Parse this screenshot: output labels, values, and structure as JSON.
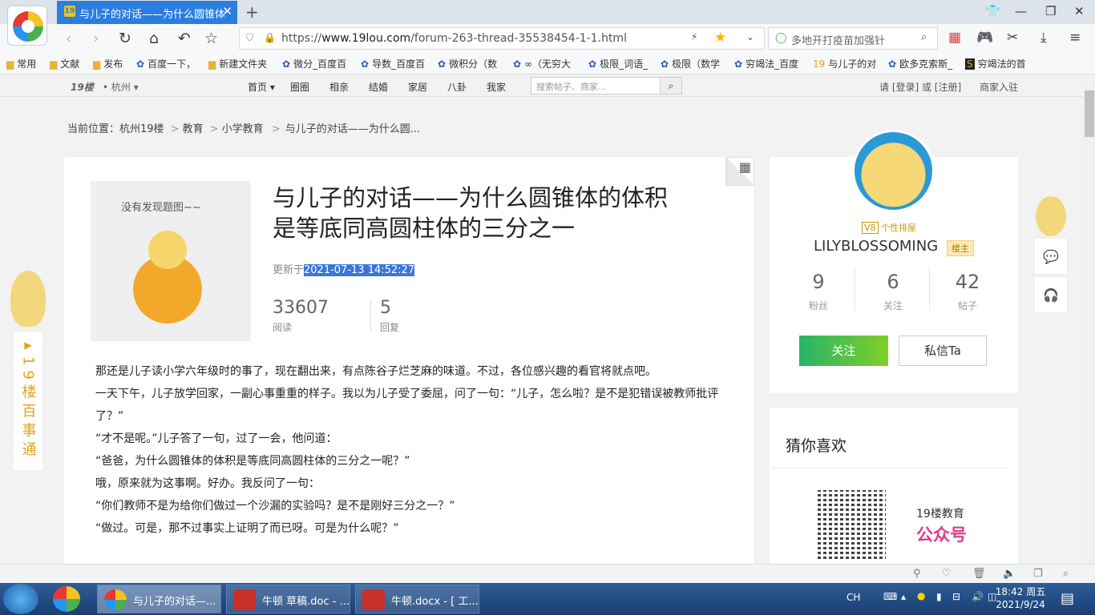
{
  "browser": {
    "tab_title": "与儿子的对话——为什么圆锥体",
    "tab_icon": "19",
    "url_prefix": "https://",
    "url_domain": "www.19lou.com",
    "url_path": "/forum-263-thread-35538454-1-1.html",
    "search_placeholder": "多地开打疫苗加强针"
  },
  "bookmarks": [
    {
      "icon": "folder",
      "label": "常用"
    },
    {
      "icon": "folder",
      "label": "文献"
    },
    {
      "icon": "folder",
      "label": "发布"
    },
    {
      "icon": "paw",
      "label": "百度一下，"
    },
    {
      "icon": "folder",
      "label": "新建文件夹"
    },
    {
      "icon": "paw",
      "label": "微分_百度百"
    },
    {
      "icon": "paw",
      "label": "导数_百度百"
    },
    {
      "icon": "paw",
      "label": "微积分（数"
    },
    {
      "icon": "paw",
      "label": "∞（无穷大"
    },
    {
      "icon": "paw",
      "label": "极限_词语_"
    },
    {
      "icon": "paw",
      "label": "极限（数学"
    },
    {
      "icon": "paw",
      "label": "穷竭法_百度"
    },
    {
      "icon": "19",
      "label": "与儿子的对"
    },
    {
      "icon": "paw",
      "label": "欧多克索斯_"
    },
    {
      "icon": "s",
      "label": "穷竭法的首"
    }
  ],
  "site": {
    "logo": "19楼",
    "city": "• 杭州",
    "nav": [
      "首页",
      "圈圈",
      "相亲",
      "结婚",
      "家居",
      "八卦",
      "我家"
    ],
    "search_placeholder": "搜索帖子、商家...",
    "login_text": "请 [登录] 或 [注册]",
    "merchant": "商家入驻"
  },
  "breadcrumb": {
    "prefix": "当前位置：",
    "items": [
      "杭州19楼",
      ">",
      "教育",
      ">",
      "小学教育",
      ">",
      "与儿子的对话——为什么圆..."
    ]
  },
  "post": {
    "no_image_text": "没有发现题图~~",
    "title": "与儿子的对话——为什么圆锥体的体积是等底同高圆柱体的三分之一",
    "updated_label": "更新于",
    "updated_time": "2021-07-13 14:52:27",
    "views": "33607",
    "views_label": "阅读",
    "replies": "5",
    "replies_label": "回复",
    "paragraphs": [
      "那还是儿子读小学六年级时的事了，现在翻出来，有点陈谷子烂芝麻的味道。不过，各位感兴趣的看官将就点吧。",
      "一天下午，儿子放学回家，一副心事重重的样子。我以为儿子受了委屈，问了一句：“儿子，怎么啦？是不是犯错误被教师批评了？”",
      "“才不是呢。”儿子答了一句，过了一会，他问道：",
      "“爸爸，为什么圆锥体的体积是等底同高圆柱体的三分之一呢？”",
      "哦，原来就为这事啊。好办。我反问了一句：",
      "“你们教师不是为给你们做过一个沙漏的实验吗？是不是刚好三分之一？”",
      "“做过。可是，那不过事实上证明了而已呀。可是为什么呢？”"
    ]
  },
  "author": {
    "level": "V8",
    "personal": "个性排屋",
    "name": "LILYBLOSSOMING",
    "badge": "楼主",
    "fans": "9",
    "fans_label": "粉丝",
    "following": "6",
    "following_label": "关注",
    "posts": "42",
    "posts_label": "帖子",
    "follow_btn": "关注",
    "message_btn": "私信Ta"
  },
  "recommend": {
    "title": "猜你喜欢",
    "line1": "19楼教育",
    "line2": "公众号"
  },
  "left_ad": "19楼百事通",
  "taskbar": {
    "items": [
      "与儿子的对话—...",
      "牛顿 草稿.doc - ...",
      "牛顿.docx - [ 工..."
    ],
    "tray_lang": "CH",
    "time": "18:42 周五",
    "date": "2021/9/24"
  }
}
